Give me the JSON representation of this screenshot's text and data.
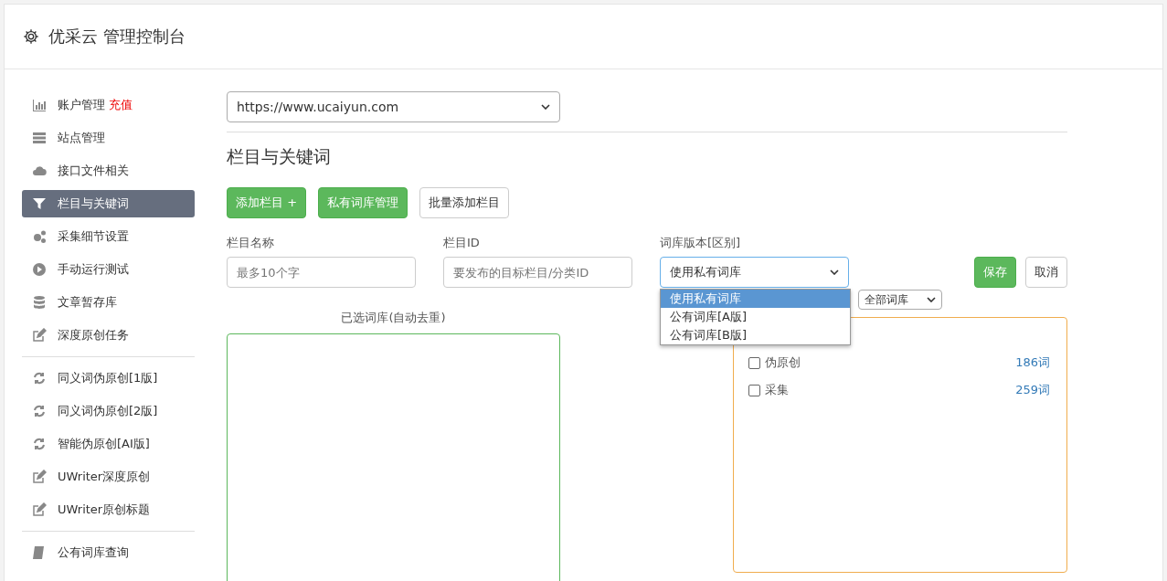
{
  "header": {
    "title": "优采云 管理控制台"
  },
  "sidebar": {
    "groups": [
      {
        "items": [
          {
            "label": "账户管理",
            "badge": "充值",
            "selected": false
          },
          {
            "label": "站点管理",
            "selected": false
          },
          {
            "label": "接口文件相关",
            "selected": false
          },
          {
            "label": "栏目与关键词",
            "selected": true
          },
          {
            "label": "采集细节设置",
            "selected": false
          },
          {
            "label": "手动运行测试",
            "selected": false
          },
          {
            "label": "文章暂存库",
            "selected": false
          },
          {
            "label": "深度原创任务",
            "selected": false
          }
        ]
      },
      {
        "items": [
          {
            "label": "同义词伪原创[1版]",
            "selected": false
          },
          {
            "label": "同义词伪原创[2版]",
            "selected": false
          },
          {
            "label": "智能伪原创[AI版]",
            "selected": false
          },
          {
            "label": "UWriter深度原创",
            "selected": false
          },
          {
            "label": "UWriter原创标题",
            "selected": false
          }
        ]
      },
      {
        "items": [
          {
            "label": "公有词库查询",
            "selected": false
          }
        ]
      }
    ]
  },
  "site_select": {
    "value": "https://www.ucaiyun.com"
  },
  "section_title": "栏目与关键词",
  "buttons": [
    {
      "label": "添加栏目 +",
      "kind": "primary"
    },
    {
      "label": "私有词库管理",
      "kind": "primary"
    },
    {
      "label": "批量添加栏目",
      "kind": "default"
    }
  ],
  "form": {
    "name": {
      "label": "栏目名称",
      "placeholder": "最多10个字"
    },
    "id": {
      "label": "栏目ID",
      "placeholder": "要发布的目标栏目/分类ID"
    },
    "version": {
      "label": "词库版本[区别]",
      "value": "使用私有词库",
      "options": [
        {
          "label": "使用私有词库",
          "selected": true
        },
        {
          "label": "公有词库[A版]",
          "selected": false
        },
        {
          "label": "公有词库[B版]",
          "selected": false
        }
      ]
    },
    "save": "保存",
    "cancel": "取消"
  },
  "selected_panel": {
    "title": "已选词库(自动去重)"
  },
  "library_panel": {
    "filter": "全部词库",
    "rows": [
      {
        "label": "伪原创",
        "count": "186词",
        "checked": false
      },
      {
        "label": "采集",
        "count": "259词",
        "checked": false
      }
    ]
  }
}
